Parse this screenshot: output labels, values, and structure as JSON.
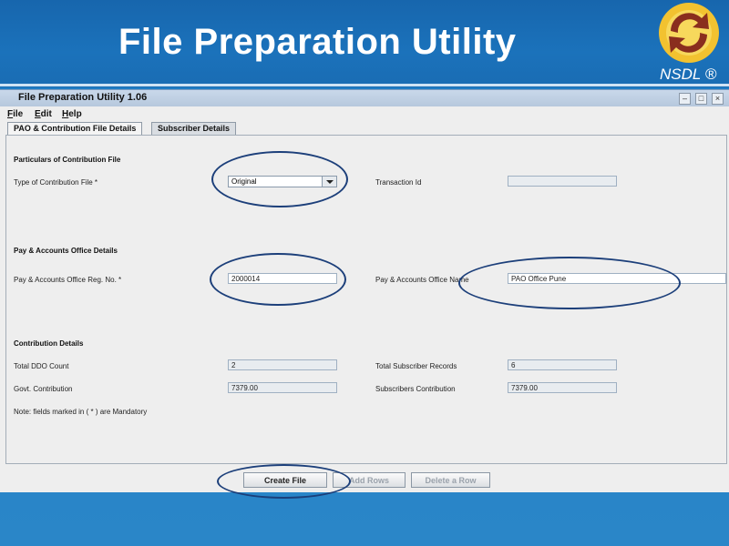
{
  "slide": {
    "title": "File Preparation Utility",
    "logo_text": "NSDL ®",
    "logo_icon": "nsdl-logo-icon"
  },
  "window": {
    "title": "File Preparation Utility 1.06",
    "controls": [
      "–",
      "□",
      "×"
    ]
  },
  "menu": {
    "file": {
      "first": "F",
      "rest": "ile"
    },
    "edit": {
      "first": "E",
      "rest": "dit"
    },
    "help": {
      "first": "H",
      "rest": "elp"
    }
  },
  "tabs": [
    {
      "label": "PAO & Contribution File Details",
      "active": true
    },
    {
      "label": "Subscriber Details",
      "active": false
    }
  ],
  "sections": {
    "particulars": {
      "heading": "Particulars of Contribution File",
      "type_label": "Type of Contribution File *",
      "type_value": "Original",
      "transaction_label": "Transaction Id",
      "transaction_value": ""
    },
    "pao": {
      "heading": "Pay & Accounts Office Details",
      "reg_label": "Pay & Accounts Office Reg. No. *",
      "reg_value": "2000014",
      "name_label": "Pay & Accounts Office Name",
      "name_value": "PAO Office Pune"
    },
    "contribution": {
      "heading": "Contribution Details",
      "ddo_label": "Total DDO Count",
      "ddo_value": "2",
      "records_label": "Total Subscriber Records",
      "records_value": "6",
      "govt_label": "Govt. Contribution",
      "govt_value": "7379.00",
      "subs_label": "Subscribers Contribution",
      "subs_value": "7379.00",
      "note": "Note: fields marked in ( * ) are Mandatory"
    }
  },
  "buttons": {
    "create": "Create File",
    "add_rows": "Add Rows",
    "delete_row": "Delete a Row"
  },
  "colors": {
    "slide_bg": "#1b72bb",
    "highlight_ellipse": "#1c3f7a"
  }
}
